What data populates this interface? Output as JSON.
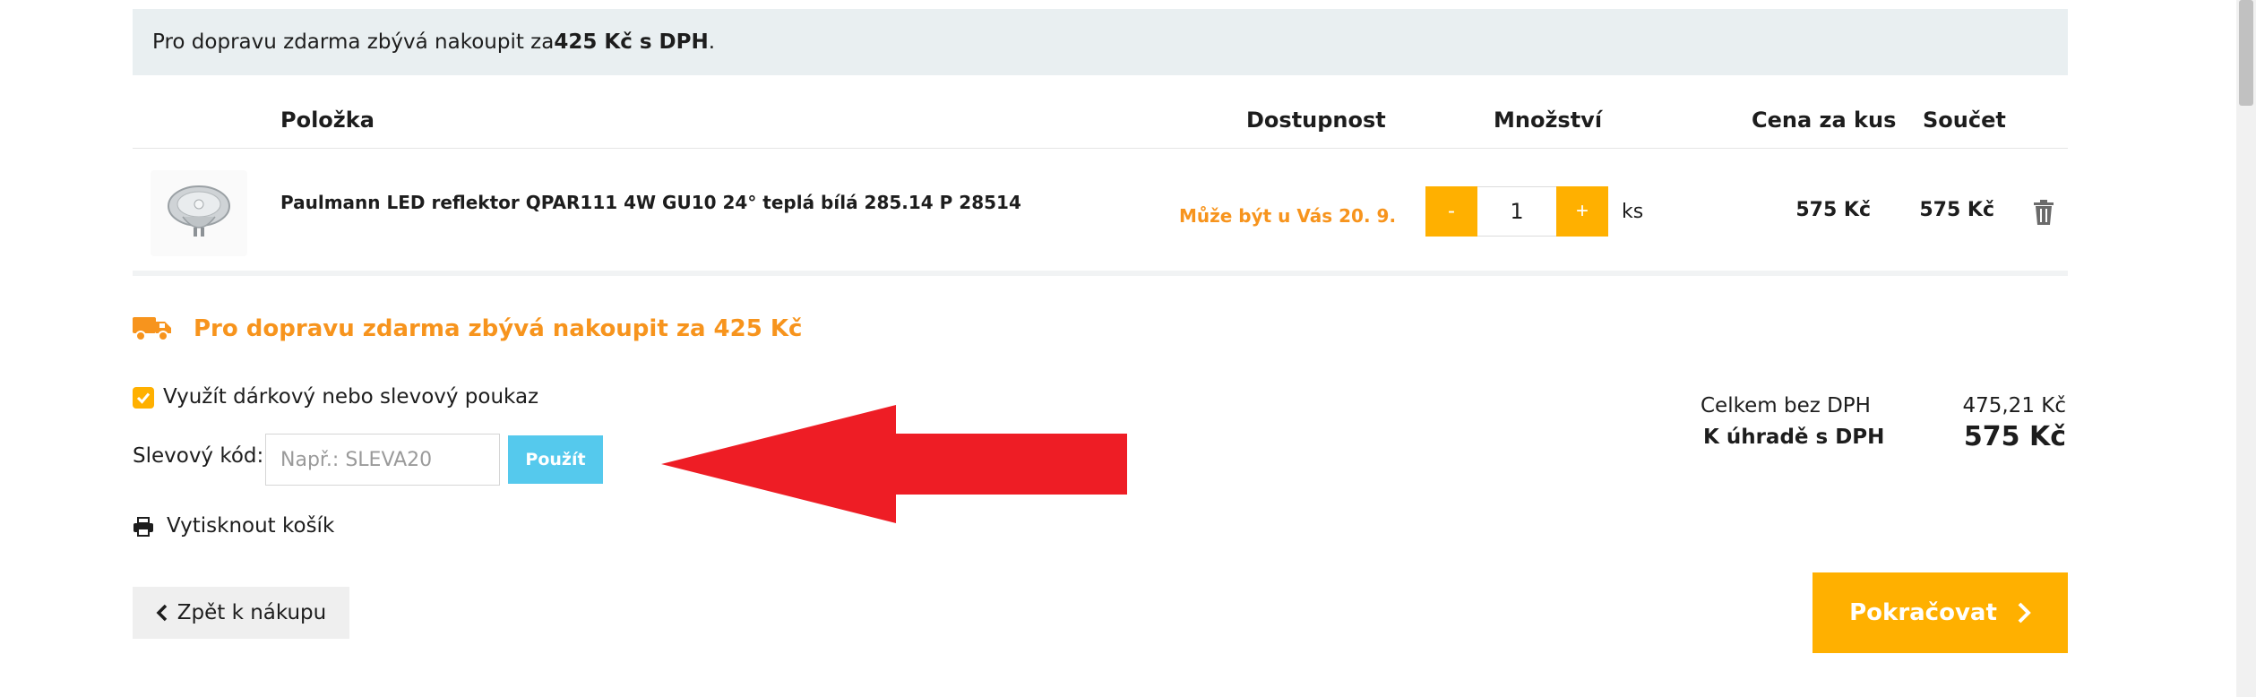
{
  "notice": {
    "prefix": "Pro dopravu zdarma zbývá nakoupit za ",
    "amount": "425 Kč s DPH",
    "suffix": "."
  },
  "table": {
    "headers": {
      "item": "Položka",
      "availability": "Dostupnost",
      "quantity": "Množství",
      "unit_price": "Cena za kus",
      "total": "Součet"
    },
    "rows": [
      {
        "name": "Paulmann LED reflektor QPAR111 4W GU10 24° teplá bílá 285.14 P 28514",
        "availability": "Může být u Vás 20. 9.",
        "minus_label": "-",
        "qty": "1",
        "plus_label": "+",
        "unit": "ks",
        "unit_price": "575 Kč",
        "total": "575 Kč"
      }
    ]
  },
  "shipping": {
    "text": "Pro dopravu zdarma zbývá nakoupit za 425 Kč"
  },
  "voucher": {
    "checkbox_label": "Využít dárkový nebo slevový poukaz",
    "code_label": "Slevový kód:",
    "placeholder": "Např.: SLEVA20",
    "apply_label": "Použít"
  },
  "print": {
    "label": "Vytisknout košík"
  },
  "totals": {
    "without_vat_label": "Celkem bez DPH",
    "without_vat_value": "475,21 Kč",
    "to_pay_label": "K úhradě s DPH",
    "to_pay_value": "575 Kč"
  },
  "nav": {
    "back_label": "Zpět k nákupu",
    "continue_label": "Pokračovat"
  },
  "colors": {
    "accent": "#ffb000",
    "availability": "#f7941d",
    "apply_button": "#55c9ed",
    "annotation_arrow": "#ee1d25"
  },
  "icons": [
    "delivery-truck-icon",
    "check-icon",
    "printer-icon",
    "trash-icon",
    "chevron-left-icon",
    "chevron-right-icon"
  ]
}
